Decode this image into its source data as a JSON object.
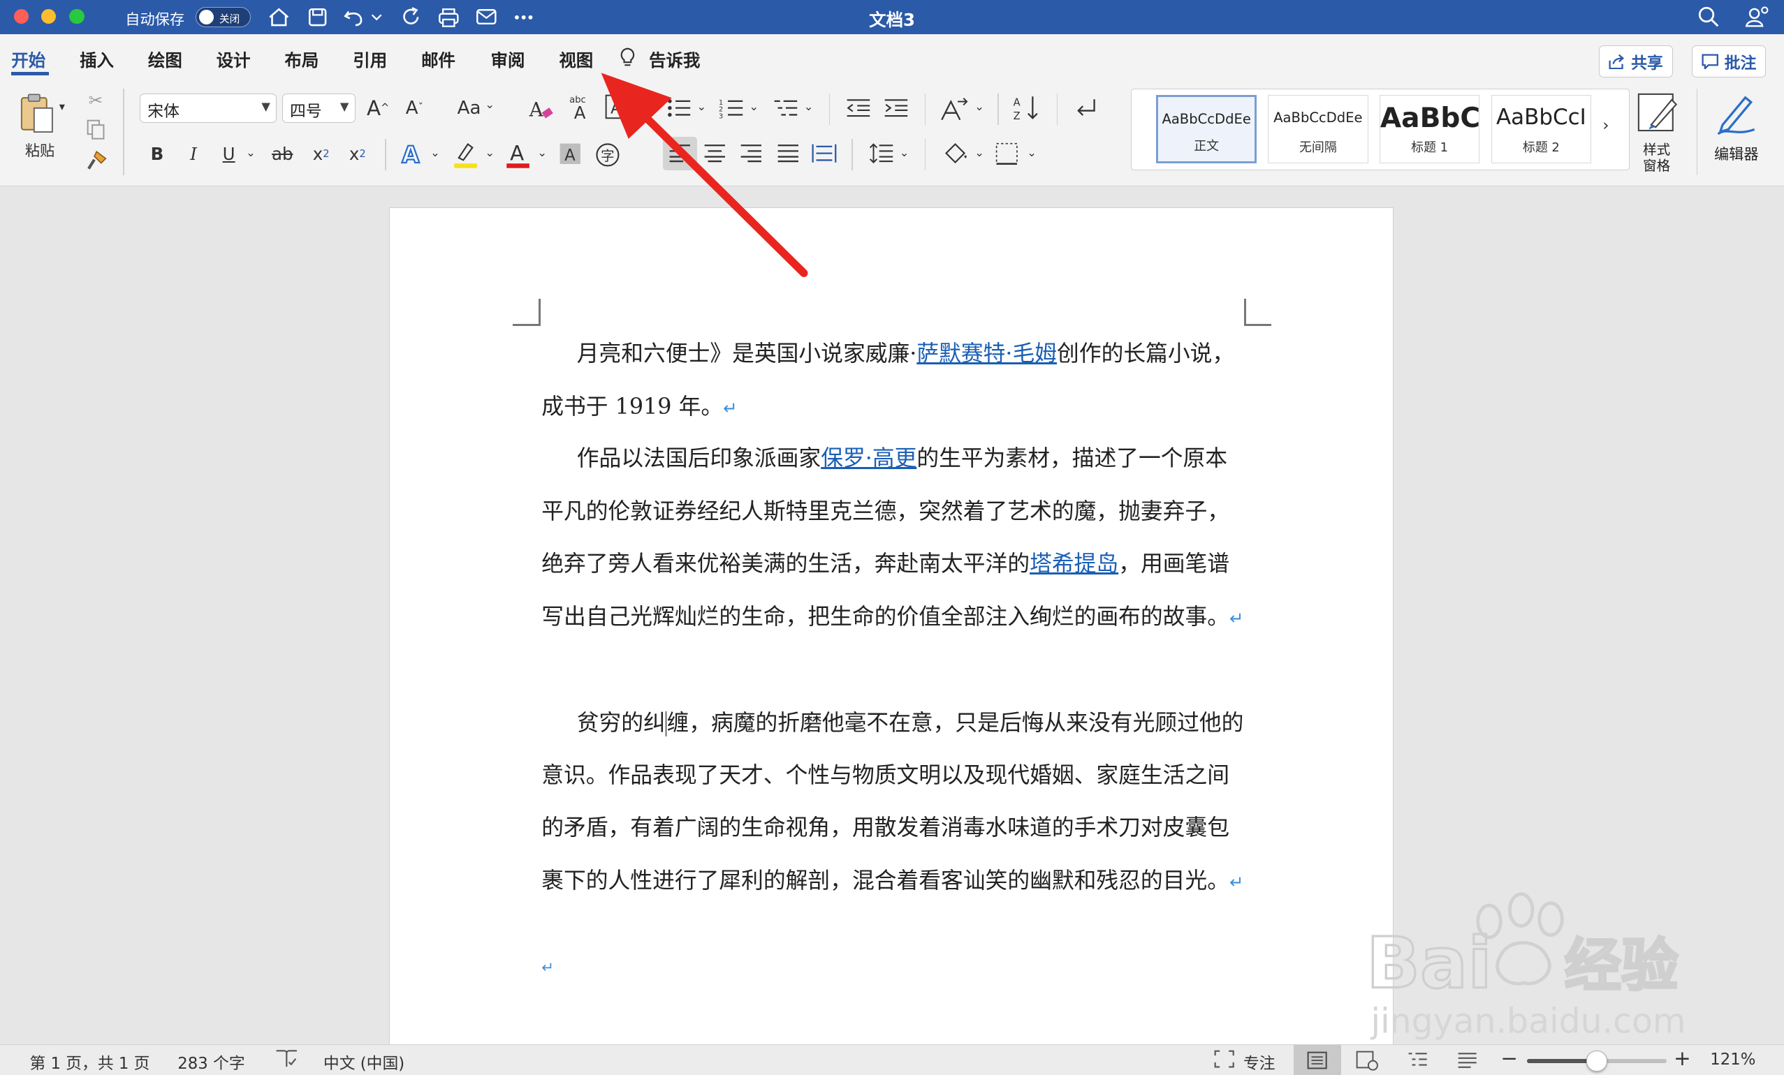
{
  "window": {
    "autosave_label": "自动保存",
    "autosave_state": "关闭",
    "title": "文档3"
  },
  "tabs": [
    {
      "label": "开始",
      "active": true
    },
    {
      "label": "插入"
    },
    {
      "label": "绘图"
    },
    {
      "label": "设计"
    },
    {
      "label": "布局"
    },
    {
      "label": "引用"
    },
    {
      "label": "邮件"
    },
    {
      "label": "审阅"
    },
    {
      "label": "视图"
    }
  ],
  "tell_me": "告诉我",
  "share_label": "共享",
  "comments_label": "批注",
  "ribbon": {
    "paste_label": "粘贴",
    "font_name": "宋体",
    "font_size": "四号",
    "case_label": "Aa",
    "bold": "B",
    "italic": "I",
    "underline": "U",
    "strike": "ab",
    "subscript": "x",
    "superscript": "x",
    "styles": [
      {
        "preview": "AaBbCcDdEe",
        "name": "正文",
        "selected": true
      },
      {
        "preview": "AaBbCcDdEe",
        "name": "无间隔"
      },
      {
        "preview": "AaBbC",
        "name": "标题 1"
      },
      {
        "preview": "AaBbCcI",
        "name": "标题 2"
      }
    ],
    "styles_pane_label": "样式\n窗格",
    "styles_pane_line1": "样式",
    "styles_pane_line2": "窗格",
    "editor_label": "编辑器"
  },
  "document": {
    "p1_before": "月亮和六便士》是英国小说家威廉·",
    "p1_link": "萨默赛特·毛姆",
    "p1_after": "创作的长篇小说，成书于 1919 年。",
    "p2_before": "作品以法国后印象派画家",
    "p2_link1": "保罗·高更",
    "p2_mid": "的生平为素材，描述了一个原本平凡的伦敦证券经纪人斯特里克兰德，突然着了艺术的魔，抛妻弃子，绝弃了旁人看来优裕美满的生活，奔赴南太平洋的",
    "p2_link2": "塔希提岛",
    "p2_after": "，用画笔谱写出自己光辉灿烂的生命，把生命的价值全部注入绚烂的画布的故事。",
    "p3_before_caret": "贫穷的纠",
    "p3_after_caret": "缠，病魔的折磨他毫不在意，只是后悔从来没有光顾过他的意识。作品表现了天才、个性与物质文明以及现代婚姻、家庭生活之间的矛盾，有着广阔的生命视角，用散发着消毒水味道的手术刀对皮囊包裹下的人性进行了犀利的解剖，混合着看客讪笑的幽默和残忍的目光。",
    "return_mark": "↵"
  },
  "status": {
    "page": "第 1 页，共 1 页",
    "words": "283 个字",
    "language": "中文 (中国)",
    "focus": "专注",
    "zoom": "121%",
    "zoom_fraction": 0.5
  },
  "watermark": {
    "brand": "Bai",
    "brand2": "经验",
    "url": "jingyan.baidu.com"
  },
  "colors": {
    "accent": "#2b5aa8",
    "link": "#1a5fb4",
    "annotation_arrow": "#e8261f"
  }
}
